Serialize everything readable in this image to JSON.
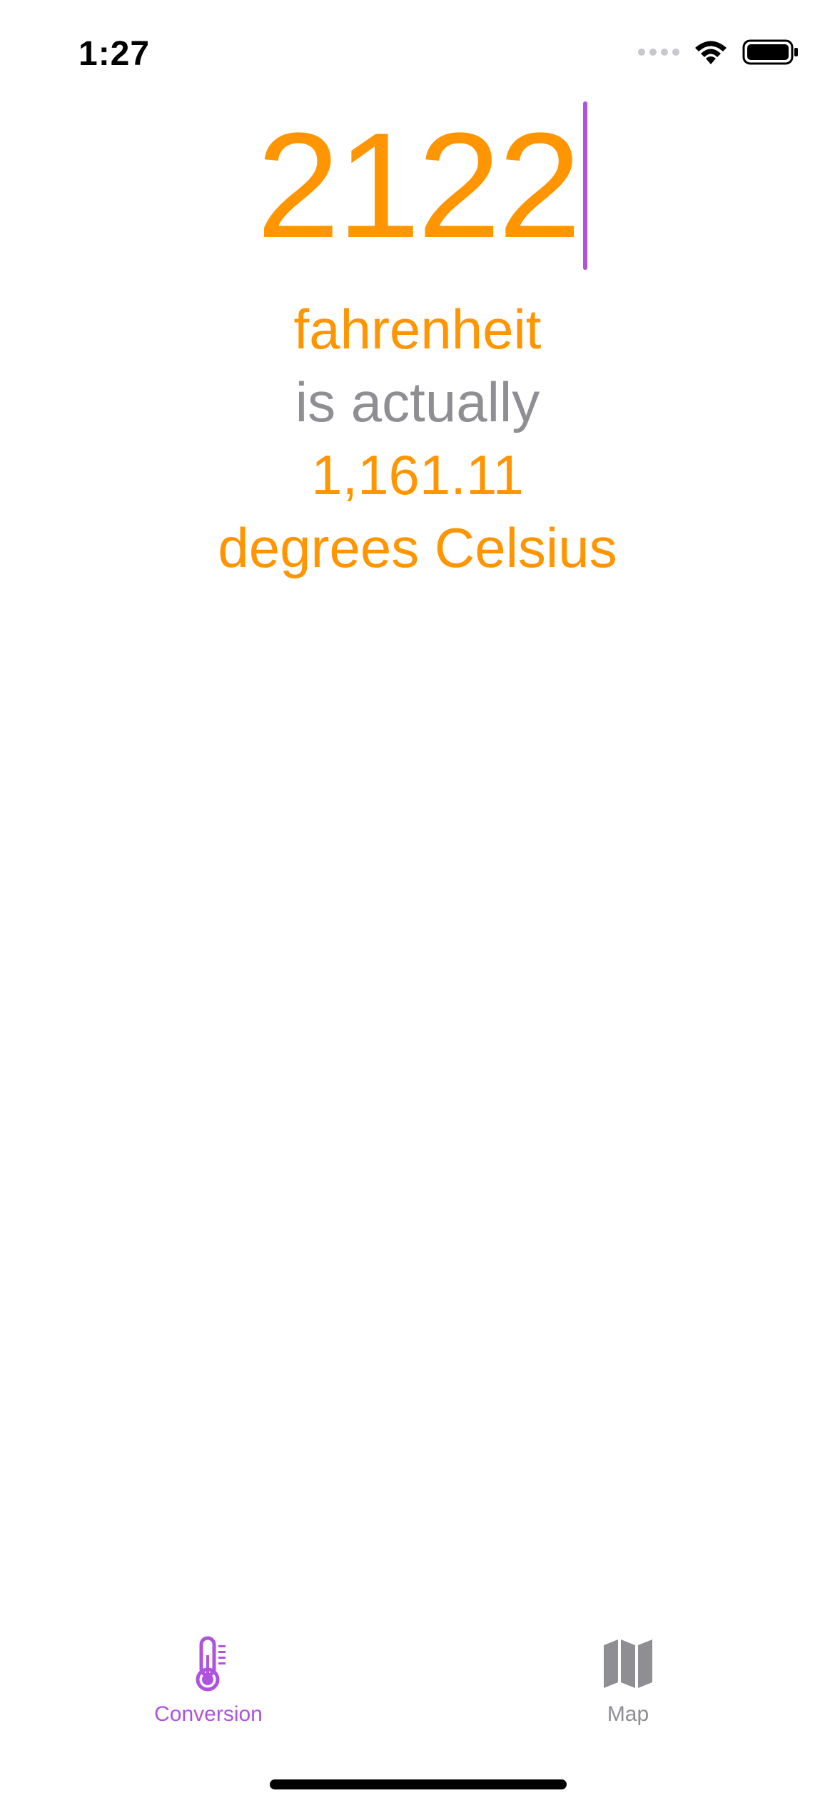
{
  "status_bar": {
    "time": "1:27"
  },
  "conversion": {
    "input_value": "2122",
    "input_unit": "fahrenheit",
    "connector": "is actually",
    "result_value": "1,161.11",
    "result_unit": "degrees Celsius"
  },
  "tabs": [
    {
      "label": "Conversion",
      "icon": "thermometer-icon",
      "selected": true
    },
    {
      "label": "Map",
      "icon": "map-icon",
      "selected": false
    }
  ],
  "colors": {
    "accent": "#ff9500",
    "tint": "#af52de",
    "secondary": "#8e8e93"
  }
}
